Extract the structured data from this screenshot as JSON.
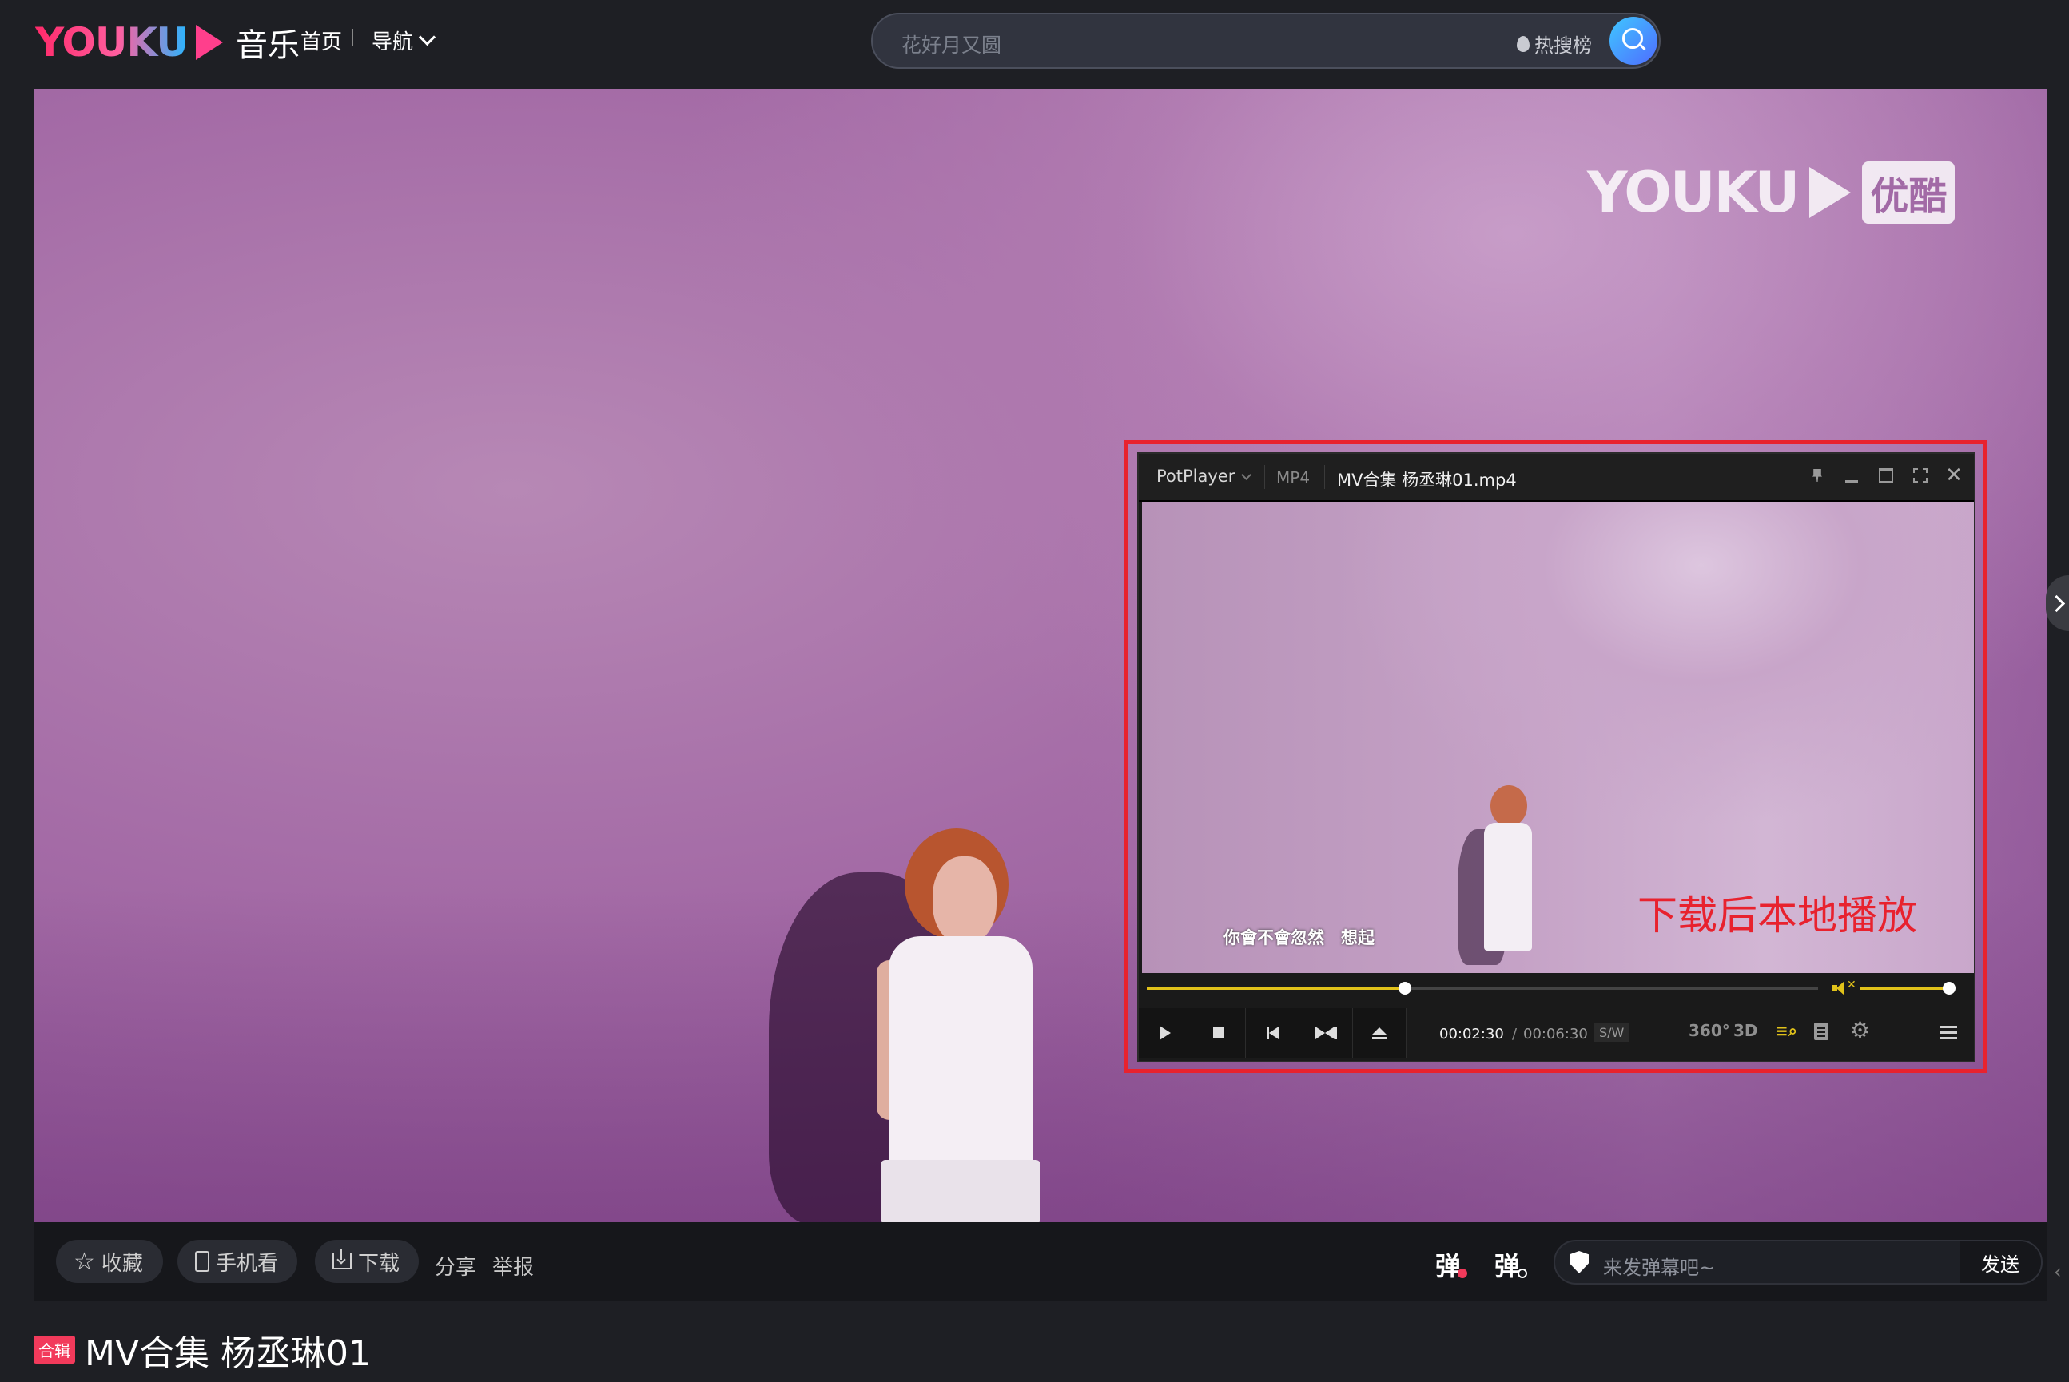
{
  "header": {
    "logo_text": "YOUKU",
    "logo_sub": "音乐",
    "nav_home": "首页",
    "nav_guide": "导航",
    "search_placeholder": "花好月又圆",
    "hot_label": "热搜榜"
  },
  "player": {
    "watermark_text": "YOUKU",
    "watermark_badge": "优酷",
    "highlight_color": "#e8222e"
  },
  "potplayer": {
    "app_name": "PotPlayer",
    "format": "MP4",
    "file_name": "MV合集 杨丞琳01.mp4",
    "subtitle_line": "你會不會忽然　想起",
    "overlay_note": "下载后本地播放",
    "time_current": "00:02:30",
    "time_separator": "/",
    "time_total": "00:06:30",
    "sw_label": "S/W",
    "progress_fraction": 0.385,
    "volume_fraction": 1.0,
    "icons": {
      "r360": "360°",
      "r3d": "3D"
    },
    "accent_color": "#e1c21a"
  },
  "actions": {
    "favorite": "收藏",
    "mobile": "手机看",
    "download": "下载",
    "share": "分享",
    "report": "举报",
    "danmaku_off": "弹",
    "danmaku_settings": "弹",
    "danmaku_placeholder": "来发弹幕吧~",
    "send": "发送"
  },
  "video_info": {
    "tag": "合辑",
    "title": "MV合集 杨丞琳01"
  }
}
